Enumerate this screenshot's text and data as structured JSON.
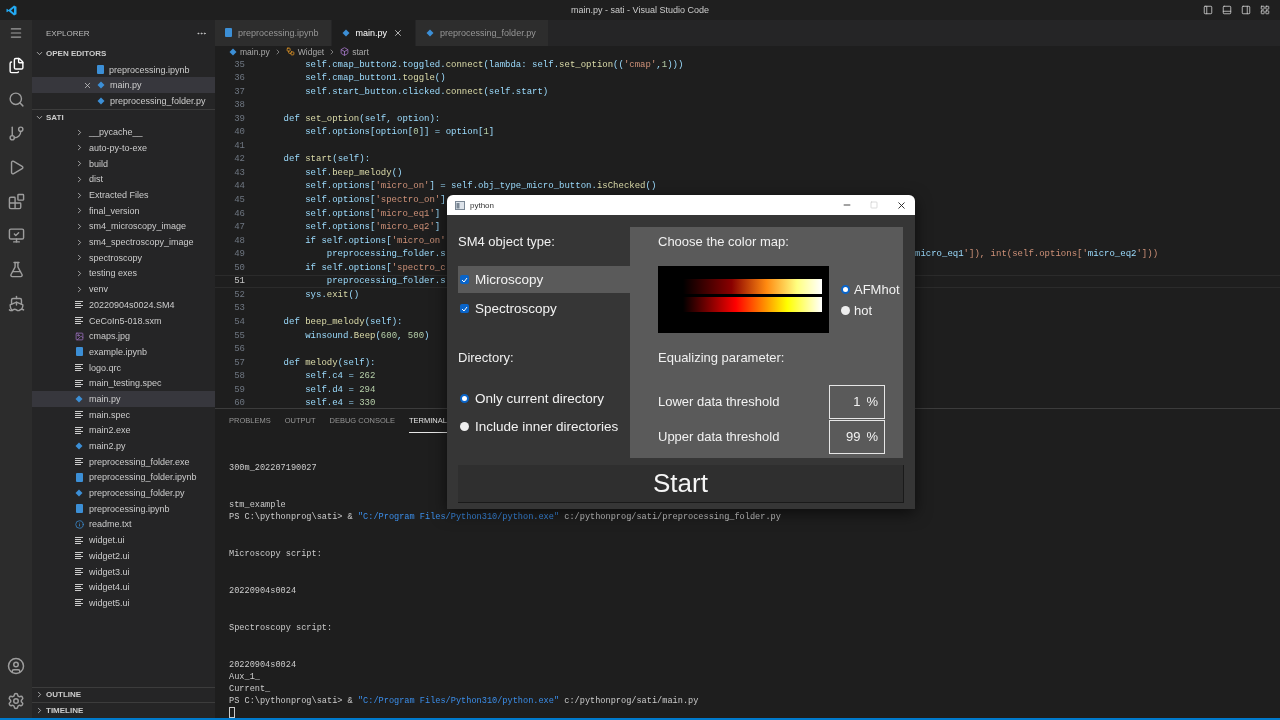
{
  "window": {
    "title": "main.py - sati - Visual Studio Code"
  },
  "explorer": {
    "title": "EXPLORER",
    "open_editors": {
      "label": "OPEN EDITORS",
      "expanded": true,
      "items": [
        {
          "name": "preprocessing.ipynb",
          "kind": "notebook",
          "selected": false
        },
        {
          "name": "main.py",
          "kind": "python",
          "selected": true
        },
        {
          "name": "preprocessing_folder.py",
          "kind": "python",
          "selected": false
        }
      ]
    },
    "folder": {
      "label": "SATI",
      "expanded": true,
      "children": [
        {
          "name": "__pycache__",
          "kind": "folder",
          "expanded": false,
          "selected": false
        },
        {
          "name": "auto-py-to-exe",
          "kind": "folder",
          "expanded": false,
          "selected": false
        },
        {
          "name": "build",
          "kind": "folder",
          "expanded": false,
          "selected": false
        },
        {
          "name": "dist",
          "kind": "folder",
          "expanded": false,
          "selected": false
        },
        {
          "name": "Extracted Files",
          "kind": "folder",
          "expanded": false,
          "selected": false
        },
        {
          "name": "final_version",
          "kind": "folder",
          "expanded": false,
          "selected": false
        },
        {
          "name": "sm4_microscopy_image",
          "kind": "folder",
          "expanded": false,
          "selected": false
        },
        {
          "name": "sm4_spectroscopy_image",
          "kind": "folder",
          "expanded": false,
          "selected": false
        },
        {
          "name": "spectroscopy",
          "kind": "folder",
          "expanded": false,
          "selected": false
        },
        {
          "name": "testing exes",
          "kind": "folder",
          "expanded": false,
          "selected": false
        },
        {
          "name": "venv",
          "kind": "folder",
          "expanded": false,
          "selected": false
        },
        {
          "name": "20220904s0024.SM4",
          "kind": "text",
          "selected": false
        },
        {
          "name": "CeCoIn5-018.sxm",
          "kind": "text",
          "selected": false
        },
        {
          "name": "cmaps.jpg",
          "kind": "image",
          "selected": false
        },
        {
          "name": "example.ipynb",
          "kind": "notebook",
          "selected": false
        },
        {
          "name": "logo.qrc",
          "kind": "text",
          "selected": false
        },
        {
          "name": "main_testing.spec",
          "kind": "text",
          "selected": false
        },
        {
          "name": "main.py",
          "kind": "python",
          "selected": true
        },
        {
          "name": "main.spec",
          "kind": "text",
          "selected": false
        },
        {
          "name": "main2.exe",
          "kind": "text",
          "selected": false
        },
        {
          "name": "main2.py",
          "kind": "python",
          "selected": false
        },
        {
          "name": "preprocessing_folder.exe",
          "kind": "text",
          "selected": false
        },
        {
          "name": "preprocessing_folder.ipynb",
          "kind": "notebook",
          "selected": false
        },
        {
          "name": "preprocessing_folder.py",
          "kind": "python",
          "selected": false
        },
        {
          "name": "preprocessing.ipynb",
          "kind": "notebook",
          "selected": false
        },
        {
          "name": "readme.txt",
          "kind": "info",
          "selected": false
        },
        {
          "name": "widget.ui",
          "kind": "text",
          "selected": false
        },
        {
          "name": "widget2.ui",
          "kind": "text",
          "selected": false
        },
        {
          "name": "widget3.ui",
          "kind": "text",
          "selected": false
        },
        {
          "name": "widget4.ui",
          "kind": "text",
          "selected": false
        },
        {
          "name": "widget5.ui",
          "kind": "text",
          "selected": false
        }
      ]
    },
    "sections": [
      {
        "label": "OUTLINE",
        "expanded": false
      },
      {
        "label": "TIMELINE",
        "expanded": false
      }
    ]
  },
  "editor": {
    "tabs": [
      {
        "label": "preprocessing.ipynb",
        "kind": "notebook",
        "selected": false
      },
      {
        "label": "main.py",
        "kind": "python",
        "selected": true
      },
      {
        "label": "preprocessing_folder.py",
        "kind": "python",
        "selected": false
      }
    ],
    "breadcrumb": [
      {
        "label": "main.py",
        "kind": "python"
      },
      {
        "label": "Widget",
        "kind": "class"
      },
      {
        "label": "start",
        "kind": "method"
      }
    ],
    "lines": [
      {
        "number": "35",
        "text": "        self.cmap_button2.toggled.connect(lambda: self.set_option(('cmap',1)))",
        "current": false
      },
      {
        "number": "36",
        "text": "        self.cmap_button1.toggle()",
        "current": false
      },
      {
        "number": "37",
        "text": "        self.start_button.clicked.connect(self.start)",
        "current": false
      },
      {
        "number": "38",
        "current": false
      },
      {
        "number": "39",
        "text": "    def set_option(self, option):",
        "current": false
      },
      {
        "number": "40",
        "text": "        self.options[option[0]] = option[1]",
        "current": false
      },
      {
        "number": "41",
        "current": false
      },
      {
        "number": "42",
        "text": "    def start(self):",
        "current": false
      },
      {
        "number": "43",
        "text": "        self.beep_melody()",
        "current": false
      },
      {
        "number": "44",
        "text": "        self.options['micro_on'] = self.obj_type_micro_button.isChecked()",
        "current": false
      },
      {
        "number": "45",
        "text": "        self.options['spectro_on']",
        "current": false
      },
      {
        "number": "46",
        "text": "        self.options['micro_eq1']",
        "current": false
      },
      {
        "number": "47",
        "text": "        self.options['micro_eq2']",
        "current": false
      },
      {
        "number": "48",
        "text": "        if self.options['micro_on'",
        "current": false
      },
      {
        "number": "49",
        "text": "            preprocessing_folder.s",
        "right_text": "micro_eq1']), int(self.options['micro_eq2']))",
        "current": false
      },
      {
        "number": "50",
        "text": "        if self.options['spectro_c",
        "current": false
      },
      {
        "number": "51",
        "text": "            preprocessing_folder.s",
        "current": true
      },
      {
        "number": "52",
        "text": "        sys.exit()",
        "current": false
      },
      {
        "number": "53",
        "current": false
      },
      {
        "number": "54",
        "text": "    def beep_melody(self):",
        "current": false
      },
      {
        "number": "55",
        "text": "        winsound.Beep(600, 500)",
        "current": false
      },
      {
        "number": "56",
        "current": false
      },
      {
        "number": "57",
        "text": "    def melody(self):",
        "current": false
      },
      {
        "number": "58",
        "text": "        self.c4 = 262",
        "current": false
      },
      {
        "number": "59",
        "text": "        self.d4 = 294",
        "current": false
      },
      {
        "number": "60",
        "text": "        self.e4 = 330",
        "current": false
      }
    ]
  },
  "panel": {
    "tabs": [
      {
        "label": "PROBLEMS",
        "selected": false
      },
      {
        "label": "OUTPUT",
        "selected": false
      },
      {
        "label": "DEBUG CONSOLE",
        "selected": false
      },
      {
        "label": "TERMINAL",
        "selected": true
      }
    ],
    "terminal": {
      "blocks": [
        {
          "lines": [
            {
              "kind": "output",
              "text": "300m_202207190027"
            }
          ]
        },
        {
          "lines": [
            {
              "kind": "output",
              "text": "stm_example"
            },
            {
              "kind": "command",
              "prompt": "PS C:\\pythonprog\\sati> &",
              "exe": "\"C:/Program Files/Python310/python.exe\"",
              "arg": "c:/pythonprog/sati/preprocessing_folder.py"
            }
          ]
        },
        {
          "lines": [
            {
              "kind": "output",
              "text": "Microscopy script:"
            }
          ]
        },
        {
          "lines": [
            {
              "kind": "output",
              "text": "20220904s0024"
            }
          ]
        },
        {
          "lines": [
            {
              "kind": "output",
              "text": "Spectroscopy script:"
            }
          ]
        },
        {
          "lines": [
            {
              "kind": "output",
              "text": "20220904s0024"
            },
            {
              "kind": "output",
              "text": "Aux_1_"
            },
            {
              "kind": "output",
              "text": "Current_"
            },
            {
              "kind": "command",
              "prompt": "PS C:\\pythonprog\\sati> &",
              "exe": "\"C:/Program Files/Python310/python.exe\"",
              "arg": "c:/pythonprog/sati/main.py"
            }
          ]
        }
      ]
    }
  },
  "dialog": {
    "title": "python",
    "object_type": {
      "label": "SM4 object type:",
      "options": [
        {
          "label": "Microscopy",
          "checked": true,
          "highlighted": true
        },
        {
          "label": "Spectroscopy",
          "checked": true,
          "highlighted": false
        }
      ]
    },
    "directory": {
      "label": "Directory:",
      "options": [
        {
          "label": "Only current directory",
          "selected": true
        },
        {
          "label": "Include inner directories",
          "selected": false
        }
      ]
    },
    "colormap": {
      "label": "Choose the color map:",
      "options": [
        {
          "label": "AFMhot",
          "selected": true
        },
        {
          "label": "hot",
          "selected": false
        }
      ]
    },
    "equalizing": {
      "label": "Equalizing parameter:",
      "fields": [
        {
          "label": "Lower data threshold",
          "value": "1",
          "unit": "%"
        },
        {
          "label": "Upper data threshold",
          "value": "99",
          "unit": "%"
        }
      ]
    },
    "start_button": "Start"
  }
}
